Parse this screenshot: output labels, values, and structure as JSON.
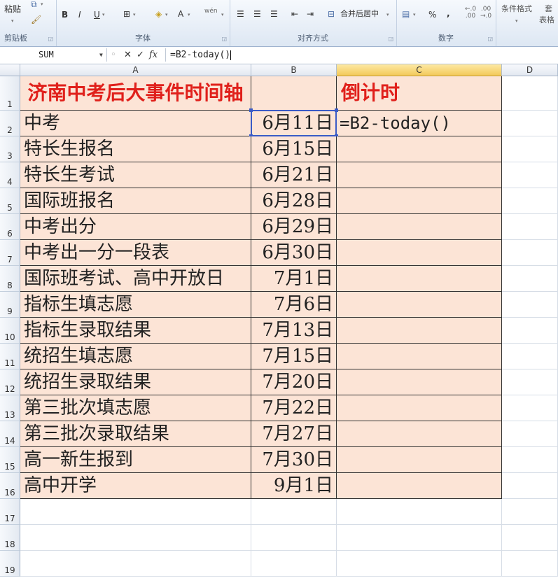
{
  "ribbon": {
    "clipboard": {
      "paste_label": "粘贴",
      "group_label": "剪贴板"
    },
    "font": {
      "group_label": "字体",
      "bold": "B",
      "italic": "I",
      "underline": "U",
      "border_icon": "⊞",
      "fill_icon": "◈",
      "color_icon": "A",
      "phonetic_icon": "wén"
    },
    "alignment": {
      "group_label": "对齐方式",
      "merge_label": "合并后居中"
    },
    "number": {
      "group_label": "数字",
      "percent": "%",
      "comma": ",",
      "inc_dec": "←.0\n.00",
      "dec_dec": ".00\n→.0"
    },
    "styles": {
      "conditional_label": "条件格式",
      "table_label_a": "套",
      "table_label_b": "表格"
    }
  },
  "formula_bar": {
    "name_box": "SUM",
    "formula": "=B2-today()",
    "cancel_icon": "✕",
    "enter_icon": "✓",
    "fx_icon": "fx"
  },
  "columns": [
    "A",
    "B",
    "C",
    "D"
  ],
  "rows": [
    "1",
    "2",
    "3",
    "4",
    "5",
    "6",
    "7",
    "8",
    "9",
    "10",
    "11",
    "12",
    "13",
    "14",
    "15",
    "16",
    "17",
    "18",
    "19"
  ],
  "sheet": {
    "title": "济南中考后大事件时间轴",
    "countdown_header": "倒计时",
    "c2_editing": "=B2-today()",
    "events": [
      {
        "name": "中考",
        "date": "6月11日"
      },
      {
        "name": "特长生报名",
        "date": "6月15日"
      },
      {
        "name": "特长生考试",
        "date": "6月21日"
      },
      {
        "name": "国际班报名",
        "date": "6月28日"
      },
      {
        "name": "中考出分",
        "date": "6月29日"
      },
      {
        "name": "中考出一分一段表",
        "date": "6月30日"
      },
      {
        "name": "国际班考试、高中开放日",
        "date": "7月1日"
      },
      {
        "name": "指标生填志愿",
        "date": "7月6日"
      },
      {
        "name": "指标生录取结果",
        "date": "7月13日"
      },
      {
        "name": "统招生填志愿",
        "date": "7月15日"
      },
      {
        "name": "统招生录取结果",
        "date": "7月20日"
      },
      {
        "name": "第三批次填志愿",
        "date": "7月22日"
      },
      {
        "name": "第三批次录取结果",
        "date": "7月27日"
      },
      {
        "name": "高一新生报到",
        "date": "7月30日"
      },
      {
        "name": "高中开学",
        "date": "9月1日"
      }
    ]
  },
  "colors": {
    "fill": "#fce4d6",
    "title_red": "#e0201b",
    "selection": "#3a5bc7",
    "header_selected": "#f3c95a"
  }
}
